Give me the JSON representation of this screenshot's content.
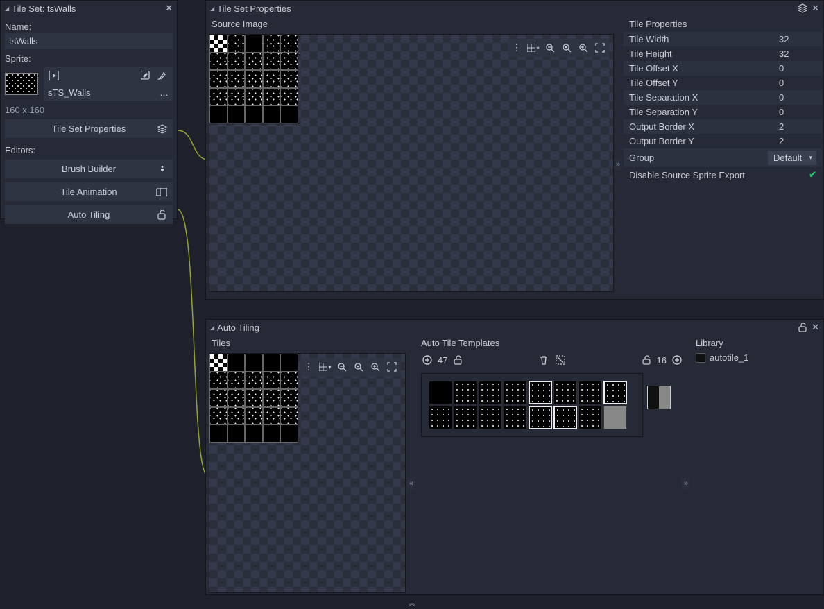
{
  "left_panel": {
    "title": "Tile Set: tsWalls",
    "name_label": "Name:",
    "name_value": "tsWalls",
    "sprite_label": "Sprite:",
    "sprite_name": "sTS_Walls",
    "dimensions": "160 x 160",
    "tsp_button": "Tile Set Properties",
    "editors_label": "Editors:",
    "brush_builder": "Brush Builder",
    "tile_animation": "Tile Animation",
    "auto_tiling": "Auto Tiling"
  },
  "props_panel": {
    "title": "Tile Set Properties",
    "source_label": "Source Image",
    "tile_props_label": "Tile Properties",
    "rows": [
      {
        "name": "Tile Width",
        "value": "32"
      },
      {
        "name": "Tile Height",
        "value": "32"
      },
      {
        "name": "Tile Offset X",
        "value": "0"
      },
      {
        "name": "Tile Offset Y",
        "value": "0"
      },
      {
        "name": "Tile Separation X",
        "value": "0"
      },
      {
        "name": "Tile Separation Y",
        "value": "0"
      },
      {
        "name": "Output Border X",
        "value": "2"
      },
      {
        "name": "Output Border Y",
        "value": "2"
      }
    ],
    "group_label": "Group",
    "group_value": "Default",
    "disable_export": "Disable Source Sprite Export"
  },
  "auto_panel": {
    "title": "Auto Tiling",
    "tiles_label": "Tiles",
    "templates_label": "Auto Tile Templates",
    "library_label": "Library",
    "template_count": "47",
    "tile_count": "16",
    "lib_item": "autotile_1"
  }
}
